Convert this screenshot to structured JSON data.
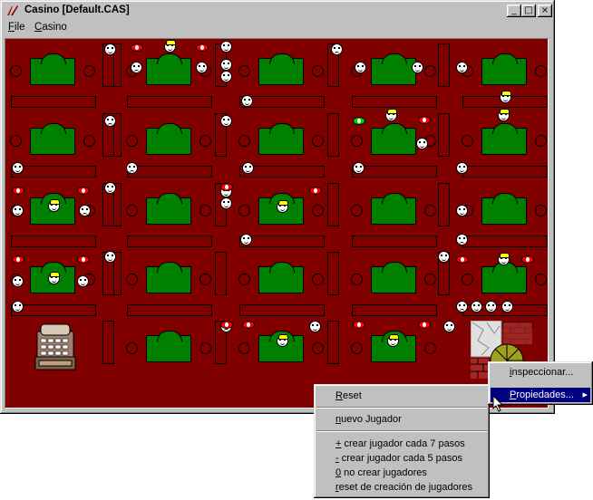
{
  "window": {
    "title": "Casino [Default.CAS]",
    "minimize_glyph": "_",
    "maximize_glyph": "□",
    "close_glyph": "×"
  },
  "menubar": {
    "items": [
      {
        "label": "File"
      },
      {
        "label": "Casino"
      }
    ]
  },
  "canvas": {
    "background": "#800000",
    "table_color": "#008000"
  },
  "context_menu": {
    "items": [
      {
        "label": "Reset"
      },
      {
        "label": "nuevo Jugador"
      },
      {
        "label": "+ crear jugador cada 7 pasos"
      },
      {
        "label": "- crear jugador cada 5 pasos"
      },
      {
        "label": "0 no crear jugadores"
      },
      {
        "label": "reset de creación de jugadores"
      }
    ]
  },
  "submenu": {
    "items": [
      {
        "label": "inspeccionar..."
      },
      {
        "label": "Propiedades...",
        "has_submenu": true,
        "submenu_arrow": "▸"
      }
    ]
  },
  "icons": {
    "app": "casino-app-icon",
    "player": "smiley-face-icon",
    "dealer": "dealer-face-icon",
    "cashier": "cash-register-icon",
    "wheel": "roulette-wheel-icon",
    "cursor": "mouse-pointer-icon"
  }
}
